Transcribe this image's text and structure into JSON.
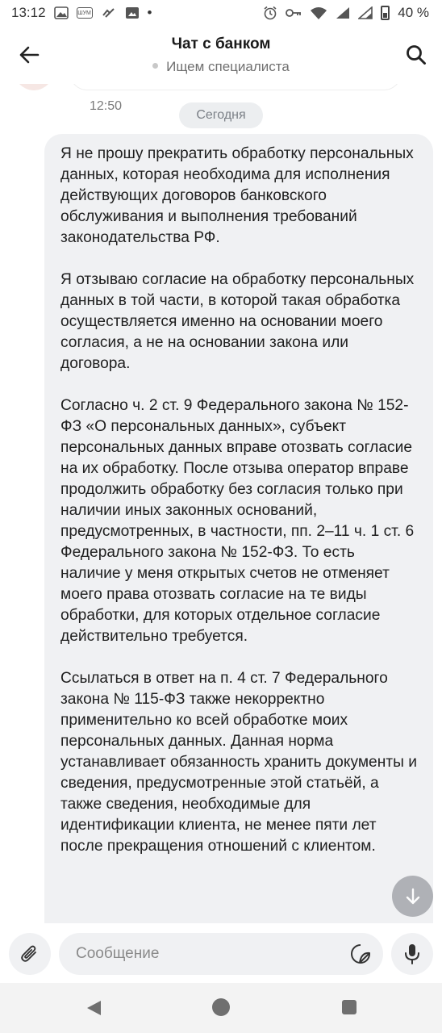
{
  "status_bar": {
    "time": "13:12",
    "battery": "40 %",
    "notification_box_label": "ШУМ",
    "notification_dot": "•"
  },
  "header": {
    "title": "Чат с банком",
    "subtitle": "Ищем специалиста",
    "back_icon": "arrow-left-icon",
    "search_icon": "search-icon"
  },
  "chat": {
    "previous_message_time": "12:50",
    "date_separator": "Сегодня",
    "message": {
      "paragraphs": [
        "Я не прошу прекратить обработку персональных данных, которая необходима для исполнения действующих договоров банковского обслуживания и выполнения требований законодательства РФ.",
        "Я отзываю согласие на обработку персональных данных в той части, в которой такая обработка осуществляется именно на основании моего согласия, а не на основании закона или договора.",
        "Согласно ч. 2 ст. 9 Федерального закона № 152-ФЗ «О персональных данных», субъект персональных данных вправе отозвать согласие на их обработку. После отзыва оператор вправе продолжить обработку без согласия только при наличии иных законных оснований, предусмотренных, в частности, пп. 2–11 ч. 1 ст. 6 Федерального закона № 152-ФЗ. То есть наличие у меня открытых счетов не отменяет моего права отозвать согласие на те виды обработки, для которых отдельное согласие действительно требуется.",
        "Ссылаться в ответ на п. 4 ст. 7 Федерального закона № 115-ФЗ также некорректно применительно ко всей обработке моих персональных данных. Данная норма устанавливает обязанность хранить документы и сведения, предусмотренные этой статьёй, а также сведения, необходимые для идентификации клиента, не менее пяти лет после прекращения отношений с клиентом."
      ]
    }
  },
  "composer": {
    "placeholder": "Сообщение",
    "attach_icon": "paperclip-icon",
    "sticker_icon": "sticker-icon",
    "mic_icon": "microphone-icon"
  },
  "colors": {
    "bubble": "#f0f1f3",
    "text": "#1f1f1f",
    "muted": "#707070"
  }
}
